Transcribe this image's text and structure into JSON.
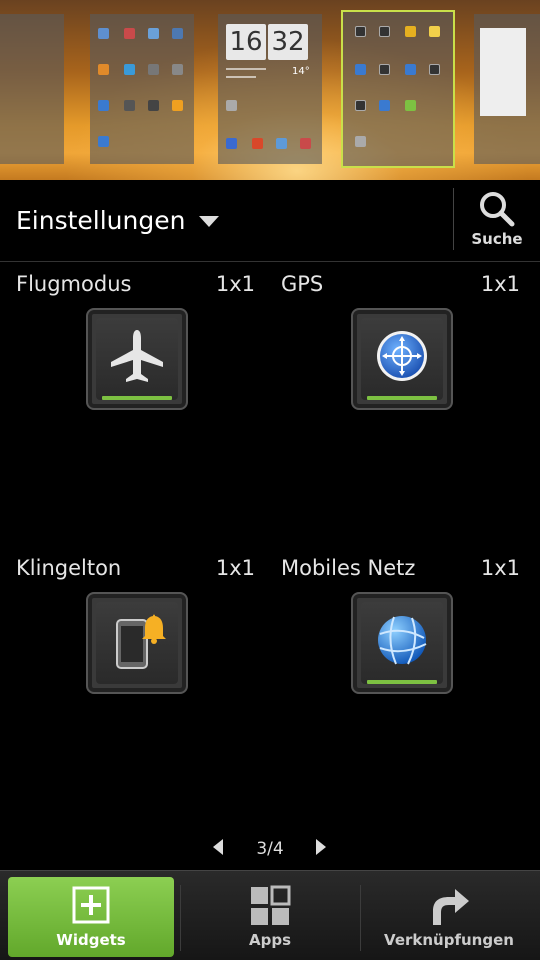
{
  "preview": {
    "clock_hours": "16",
    "clock_minutes": "32",
    "temperature": "14°"
  },
  "header": {
    "category": "Einstellungen",
    "search_label": "Suche"
  },
  "widgets": [
    {
      "name": "Flugmodus",
      "size": "1x1",
      "icon": "airplane-icon"
    },
    {
      "name": "GPS",
      "size": "1x1",
      "icon": "gps-globe-icon"
    },
    {
      "name": "Klingelton",
      "size": "1x1",
      "icon": "ringtone-phone-bell-icon"
    },
    {
      "name": "Mobiles Netz",
      "size": "1x1",
      "icon": "mobile-network-globe-icon"
    }
  ],
  "pager": {
    "page": "3/4"
  },
  "tabs": [
    {
      "label": "Widgets",
      "icon": "add-widget-icon",
      "active": true
    },
    {
      "label": "Apps",
      "icon": "apps-grid-icon",
      "active": false
    },
    {
      "label": "Verknüpfungen",
      "icon": "shortcut-arrow-icon",
      "active": false
    }
  ],
  "colors": {
    "accent_green": "#7dc142",
    "selected_panel_outline": "#c9e04a"
  }
}
